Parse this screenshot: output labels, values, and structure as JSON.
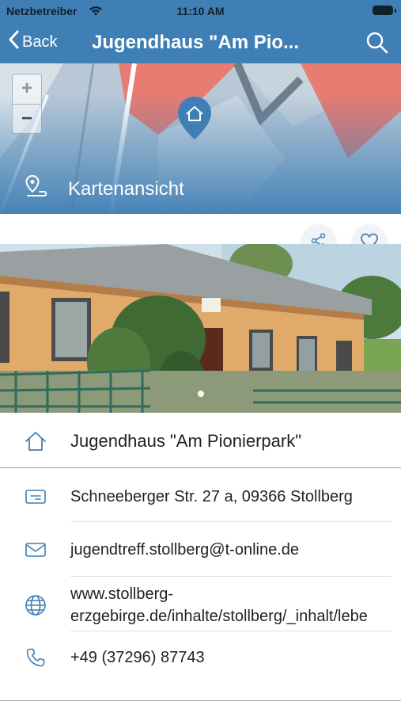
{
  "status_bar": {
    "carrier": "Netzbetreiber",
    "time": "11:10 AM",
    "wifi_icon": "wifi-icon",
    "battery_icon": "battery-icon"
  },
  "nav": {
    "back_label": "Back",
    "title": "Jugendhaus \"Am Pio...",
    "search_icon": "search-icon"
  },
  "map": {
    "zoom_in": "+",
    "zoom_out": "−",
    "map_view_label": "Kartenansicht",
    "pin_icon": "home-pin-icon"
  },
  "actions": {
    "share_icon": "share-icon",
    "favorite_icon": "heart-icon"
  },
  "gallery": {
    "current": 1,
    "total": 1
  },
  "details": {
    "name": "Jugendhaus \"Am Pionierpark\"",
    "address": "Schneeberger Str. 27 a, 09366 Stollberg",
    "email": "jugendtreff.stollberg@t-online.de",
    "website_line1": "www.stollberg-",
    "website_line2": "erzgebirge.de/inhalte/stollberg/_inhalt/lebe",
    "phone": "+49 (37296) 87743"
  },
  "colors": {
    "accent": "#3f7fb5",
    "icon": "#3f7fb5"
  }
}
